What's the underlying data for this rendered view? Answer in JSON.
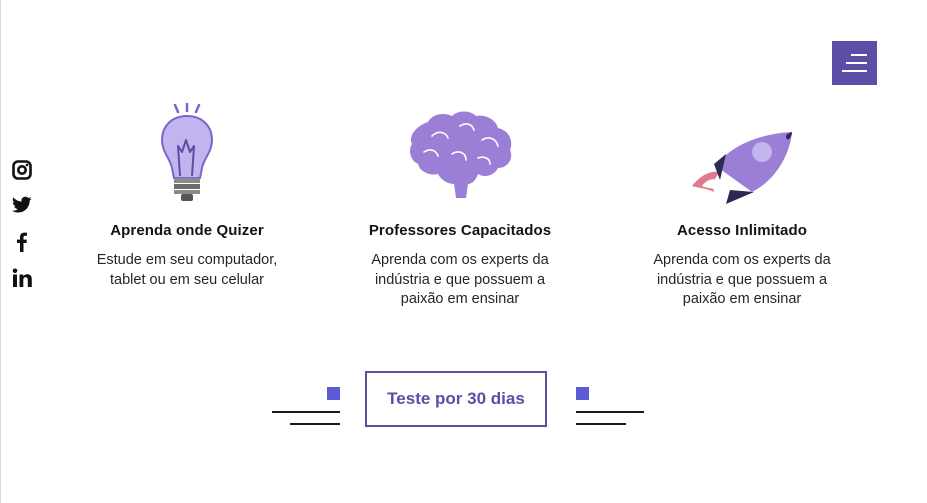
{
  "menu": {
    "icon": "hamburger-icon",
    "color": "#5a4ea6"
  },
  "social": [
    {
      "name": "instagram",
      "icon": "instagram-icon"
    },
    {
      "name": "twitter",
      "icon": "twitter-icon"
    },
    {
      "name": "facebook",
      "icon": "facebook-icon"
    },
    {
      "name": "linkedin",
      "icon": "linkedin-icon"
    }
  ],
  "features": [
    {
      "icon": "lightbulb-icon",
      "title": "Aprenda onde Quizer",
      "desc_lines": [
        "Estude em seu computador,",
        "tablet ou em seu celular"
      ]
    },
    {
      "icon": "brain-icon",
      "title": "Professores Capacitados",
      "desc_lines": [
        "Aprenda com os experts da",
        "indústria e que possuem a",
        "paixão em ensinar"
      ]
    },
    {
      "icon": "rocket-icon",
      "title": "Acesso Inlimitado",
      "desc_lines": [
        "Aprenda com os experts da",
        "indústria e que possuem a",
        "paixão em ensinar"
      ]
    }
  ],
  "cta": {
    "label": "Teste por 30 dias"
  },
  "colors": {
    "accent": "#5a4ea6",
    "lilac": "#a18bdc",
    "square": "#5b5bd6"
  }
}
